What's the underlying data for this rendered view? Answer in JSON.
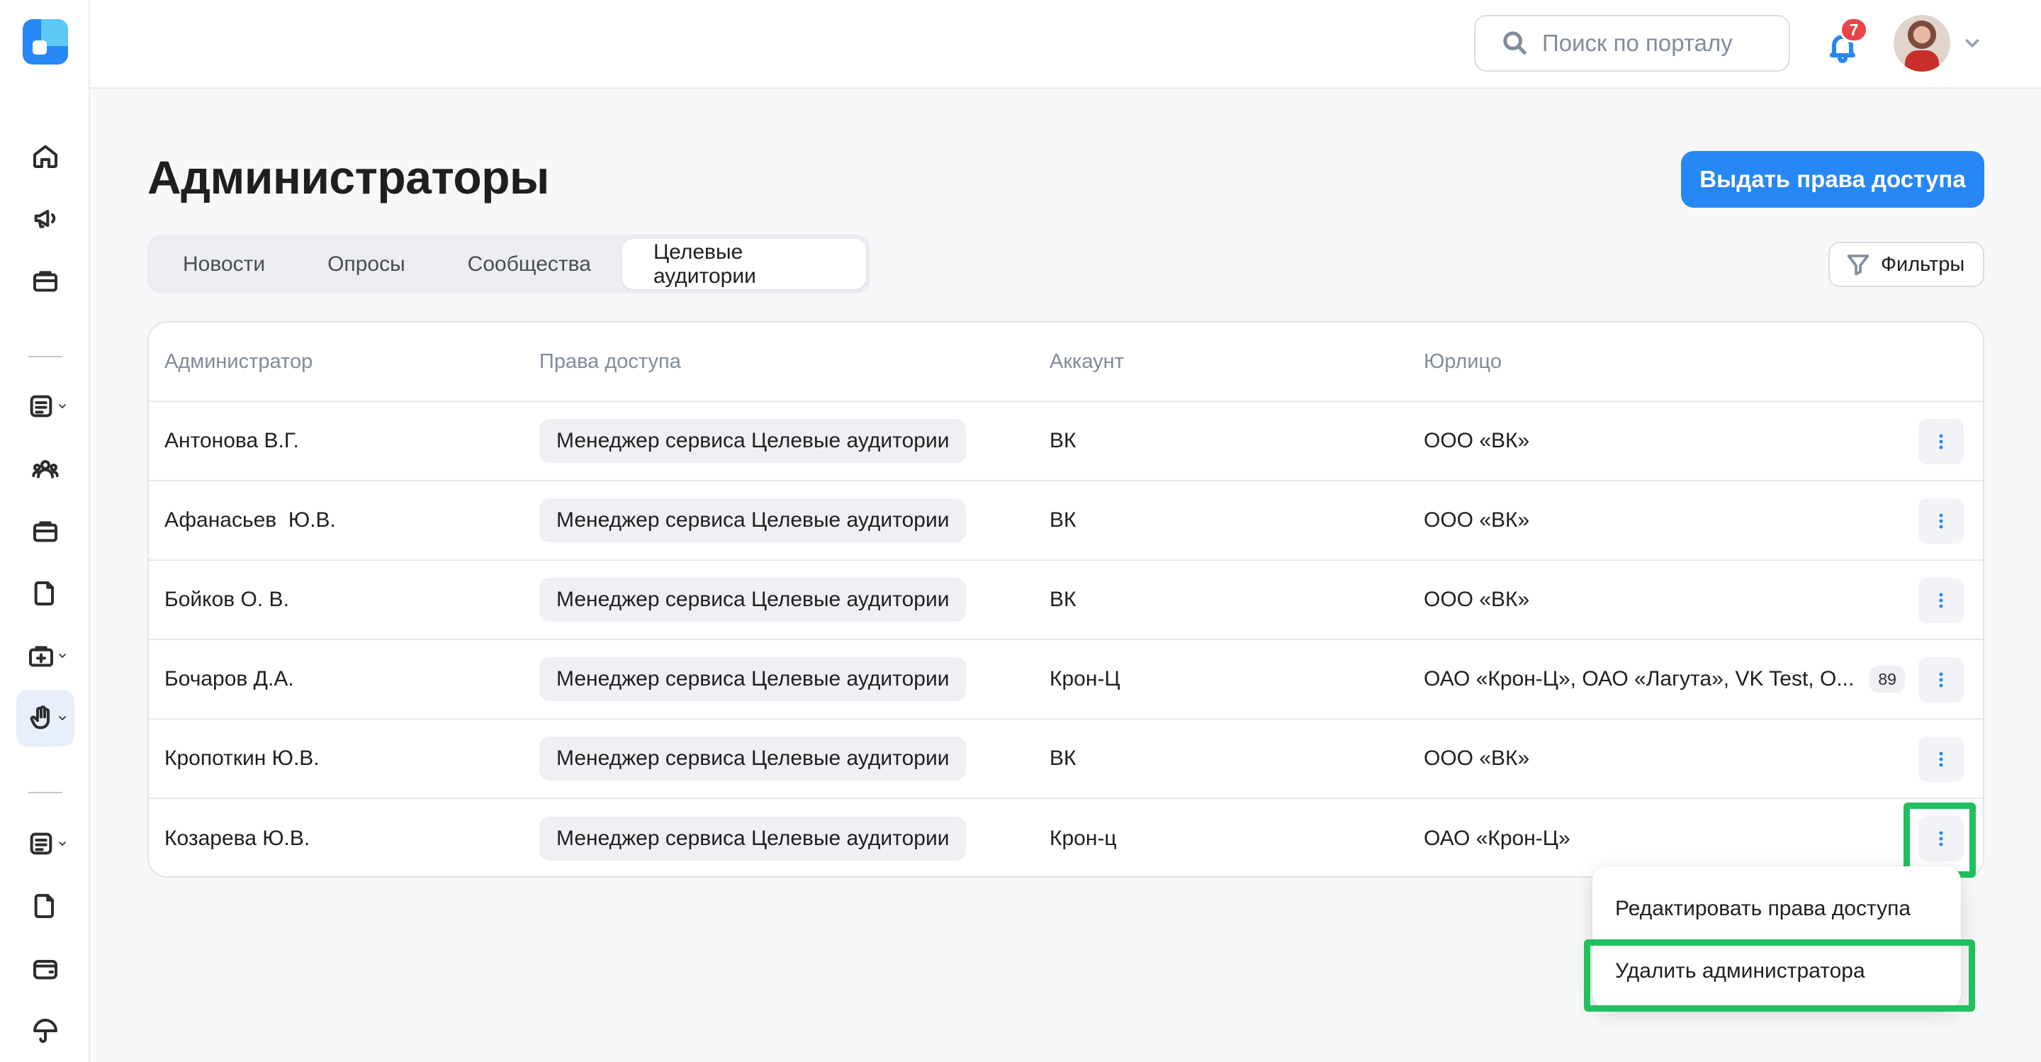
{
  "header": {
    "search_placeholder": "Поиск по порталу",
    "notifications_count": "7"
  },
  "page": {
    "title": "Администраторы",
    "grant_access_label": "Выдать права доступа",
    "filters_label": "Фильтры"
  },
  "tabs": [
    {
      "label": "Новости",
      "active": false
    },
    {
      "label": "Опросы",
      "active": false
    },
    {
      "label": "Сообщества",
      "active": false
    },
    {
      "label": "Целевые аудитории",
      "active": true
    }
  ],
  "table": {
    "columns": [
      "Администратор",
      "Права доступа",
      "Аккаунт",
      "Юрлицо"
    ],
    "rows": [
      {
        "admin": "Антонова В.Г.",
        "rights": "Менеджер сервиса Целевые аудитории",
        "account": "ВК",
        "entity": "ООО «ВК»",
        "extra": ""
      },
      {
        "admin": "Афанасьев  Ю.В.",
        "rights": "Менеджер сервиса Целевые аудитории",
        "account": "ВК",
        "entity": "ООО «ВК»",
        "extra": ""
      },
      {
        "admin": "Бойков О. В.",
        "rights": "Менеджер сервиса Целевые аудитории",
        "account": "ВК",
        "entity": "ООО «ВК»",
        "extra": ""
      },
      {
        "admin": "Бочаров Д.А.",
        "rights": "Менеджер сервиса Целевые аудитории",
        "account": "Крон-Ц",
        "entity": "ОАО «Крон-Ц», ОАО «Лагута», VK Test, О...",
        "extra": "89"
      },
      {
        "admin": "Кропоткин Ю.В.",
        "rights": "Менеджер сервиса Целевые аудитории",
        "account": "ВК",
        "entity": "ООО «ВК»",
        "extra": ""
      },
      {
        "admin": "Козарева Ю.В.",
        "rights": "Менеджер сервиса Целевые аудитории",
        "account": "Крон-ц",
        "entity": "ОАО «Крон-Ц»",
        "extra": ""
      }
    ]
  },
  "row_menu": {
    "edit_label": "Редактировать права доступа",
    "delete_label": "Удалить администратора"
  },
  "colors": {
    "accent": "#2787f5",
    "highlight": "#21c05e",
    "badge": "#e64646"
  }
}
